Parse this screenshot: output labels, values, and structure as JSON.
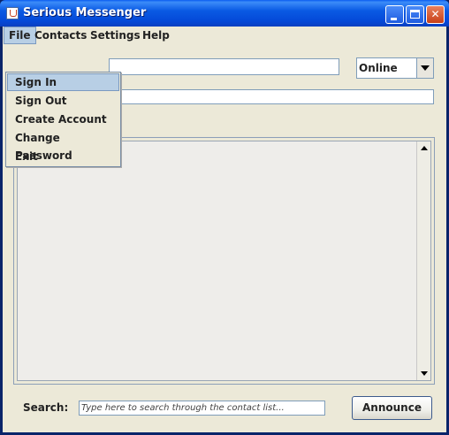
{
  "window": {
    "title": "Serious Messenger"
  },
  "menubar": {
    "items": [
      {
        "label": "File"
      },
      {
        "label": "Contacts"
      },
      {
        "label": "Settings"
      },
      {
        "label": "Help"
      }
    ]
  },
  "file_menu": {
    "items": [
      {
        "label": "Sign In"
      },
      {
        "label": "Sign Out"
      },
      {
        "label": "Create Account"
      },
      {
        "label": "Change Password"
      },
      {
        "label": "Exit"
      }
    ]
  },
  "status": {
    "selected": "Online"
  },
  "search": {
    "label": "Search:",
    "placeholder": "Type here to search through the contact list..."
  },
  "actions": {
    "announce_label": "Announce"
  },
  "colors": {
    "titlebar": "#0a5ae4",
    "window_bg": "#ece9d8",
    "menu_highlight": "#b8cfe5"
  }
}
